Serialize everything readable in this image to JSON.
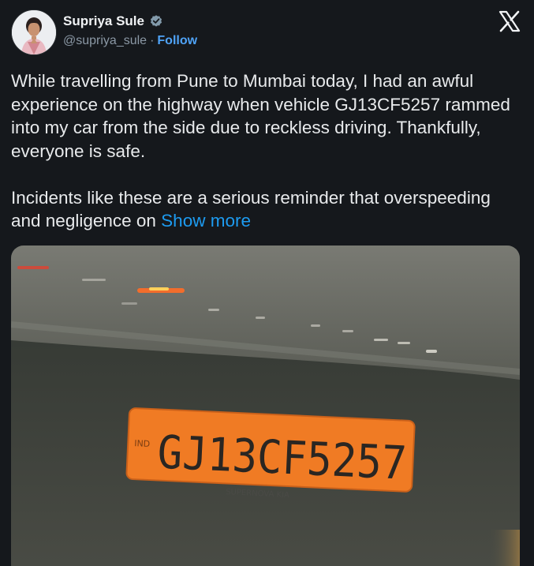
{
  "author": {
    "display_name": "Supriya Sule",
    "handle": "@supriya_sule",
    "separator": "·",
    "follow_label": "Follow",
    "verified": true,
    "avatar_icon": "person-avatar"
  },
  "platform_icon": "x-logo-icon",
  "tweet": {
    "text": "While travelling from Pune to Mumbai today, I had an awful experience on the highway when vehicle GJ13CF5257 rammed into my car from the side due to reckless driving. Thankfully, everyone is safe.\n\nIncidents like these are a serious reminder that overspeeding and negligence on ",
    "show_more_label": "Show more"
  },
  "media": {
    "plate_country": "IND",
    "plate_number": "GJ13CF5257",
    "plate_subtext": "SUPERNOVA KIA",
    "colors": {
      "plate": "#f07b24",
      "plate_text": "#2a2622"
    }
  },
  "colors": {
    "background": "#15181c",
    "text": "#e7e9ea",
    "secondary_text": "#8b98a5",
    "link": "#1d9bf0",
    "verified_badge": "#829aab"
  }
}
